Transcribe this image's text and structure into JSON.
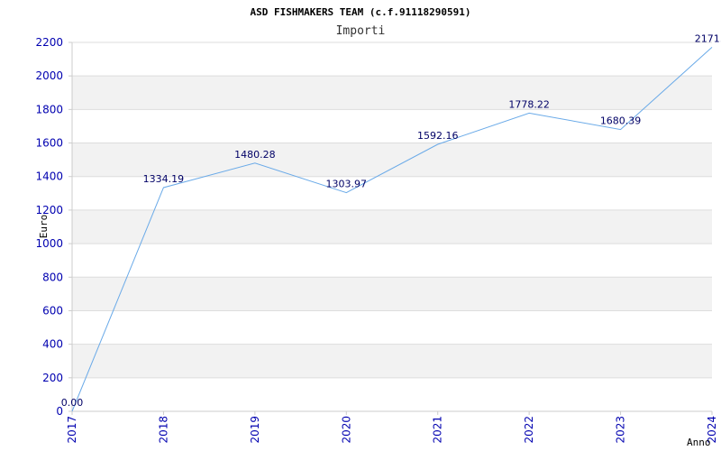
{
  "chart_data": {
    "type": "line",
    "title": "ASD FISHMAKERS TEAM (c.f.91118290591)",
    "subtitle": "Importi",
    "xlabel": "Anno",
    "ylabel": "Euro",
    "categories": [
      "2017",
      "2018",
      "2019",
      "2020",
      "2021",
      "2022",
      "2023",
      "2024"
    ],
    "values": [
      0,
      1334.19,
      1480.28,
      1303.97,
      1592.16,
      1778.22,
      1680.39,
      2171.0
    ],
    "data_labels": [
      "0.00",
      "1334.19",
      "1480.28",
      "1303.97",
      "1592.16",
      "1778.22",
      "1680.39",
      "2171.0"
    ],
    "ylim": [
      0,
      2200
    ],
    "yticks": [
      0,
      200,
      400,
      600,
      800,
      1000,
      1200,
      1400,
      1600,
      1800,
      2000,
      2200
    ],
    "grid": "horizontal bands",
    "colors": {
      "line": "#6aaae8",
      "band": "#f2f2f2",
      "tick": "#0000b0",
      "label": "#000066"
    }
  }
}
